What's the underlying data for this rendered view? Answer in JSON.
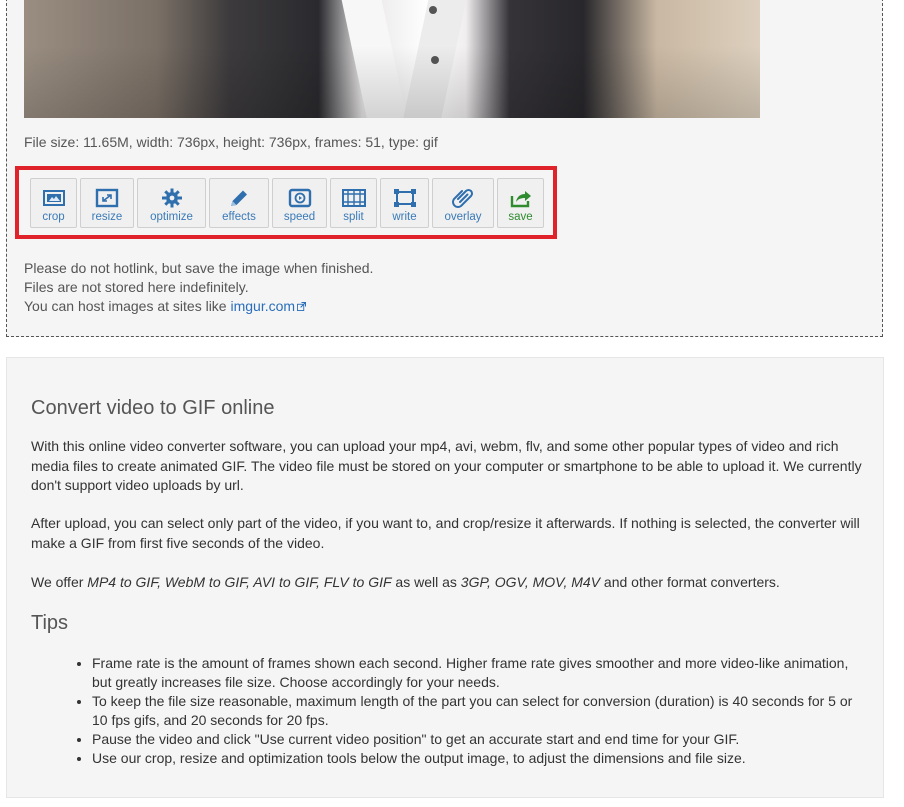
{
  "file_info": "File size: 11.65M, width: 736px, height: 736px, frames: 51, type: gif",
  "toolbar": {
    "tools": [
      {
        "id": "crop",
        "label": "crop",
        "icon": "crop-icon"
      },
      {
        "id": "resize",
        "label": "resize",
        "icon": "resize-icon"
      },
      {
        "id": "optimize",
        "label": "optimize",
        "icon": "gear-icon"
      },
      {
        "id": "effects",
        "label": "effects",
        "icon": "pencil-icon"
      },
      {
        "id": "speed",
        "label": "speed",
        "icon": "speed-icon"
      },
      {
        "id": "split",
        "label": "split",
        "icon": "film-icon"
      },
      {
        "id": "write",
        "label": "write",
        "icon": "text-frame-icon"
      },
      {
        "id": "overlay",
        "label": "overlay",
        "icon": "paperclip-icon"
      },
      {
        "id": "save",
        "label": "save",
        "icon": "share-icon"
      }
    ],
    "highlight_color": "#e0232b"
  },
  "notes": {
    "line1": "Please do not hotlink, but save the image when finished.",
    "line2": "Files are not stored here indefinitely.",
    "line3_prefix": "You can host images at sites like ",
    "line3_link": "imgur.com"
  },
  "info": {
    "title": "Convert video to GIF online",
    "para1": "With this online video converter software, you can upload your mp4, avi, webm, flv, and some other popular types of video and rich media files to create animated GIF. The video file must be stored on your computer or smartphone to be able to upload it. We currently don't support video uploads by url.",
    "para2": "After upload, you can select only part of the video, if you want to, and crop/resize it afterwards. If nothing is selected, the converter will make a GIF from first five seconds of the video.",
    "para3_a": "We offer ",
    "para3_b": "MP4 to GIF, WebM to GIF, AVI to GIF, FLV to GIF",
    "para3_c": " as well as ",
    "para3_d": "3GP, OGV, MOV, M4V",
    "para3_e": " and other format converters.",
    "tips_title": "Tips",
    "tips": [
      "Frame rate is the amount of frames shown each second. Higher frame rate gives smoother and more video-like animation, but greatly increases file size. Choose accordingly for your needs.",
      "To keep the file size reasonable, maximum length of the part you can select for conversion (duration) is 40 seconds for 5 or 10 fps gifs, and 20 seconds for 20 fps.",
      "Pause the video and click \"Use current video position\" to get an accurate start and end time for your GIF.",
      "Use our crop, resize and optimization tools below the output image, to adjust the dimensions and file size."
    ]
  }
}
